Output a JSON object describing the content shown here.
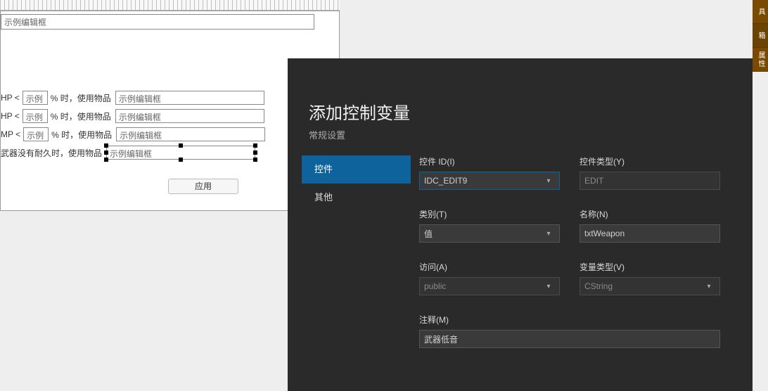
{
  "designer": {
    "top_edit": "示例编辑框",
    "rows": [
      {
        "prefix": "HP <",
        "pct": "示例",
        "mid": "% 时，使用物品",
        "item": "示例编辑框"
      },
      {
        "prefix": "HP <",
        "pct": "示例",
        "mid": "% 时，使用物品",
        "item": "示例编辑框"
      },
      {
        "prefix": "MP <",
        "pct": "示例",
        "mid": "% 时，使用物品",
        "item": "示例编辑框"
      }
    ],
    "row4_prefix": "武器没有耐久时，使用物品",
    "row4_item": "示例编辑框",
    "apply": "应用"
  },
  "wizard": {
    "title": "添加控制变量",
    "subtitle": "常规设置",
    "nav": {
      "control": "控件",
      "other": "其他"
    },
    "fields": {
      "control_id_label": "控件 ID(I)",
      "control_id_value": "IDC_EDIT9",
      "control_type_label": "控件类型(Y)",
      "control_type_value": "EDIT",
      "category_label": "类别(T)",
      "category_value": "值",
      "name_label": "名称(N)",
      "name_value": "txtWeapon",
      "access_label": "访问(A)",
      "access_value": "public",
      "vartype_label": "变量类型(V)",
      "vartype_value": "CString",
      "comment_label": "注释(M)",
      "comment_value": "武器低音"
    }
  },
  "right_tabs": [
    "具",
    "工具箱",
    "属性"
  ]
}
